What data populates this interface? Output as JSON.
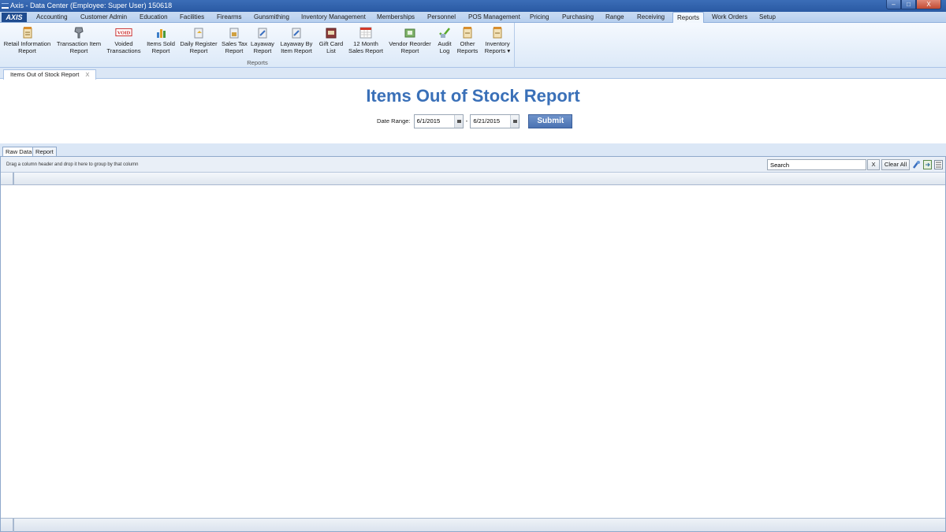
{
  "window": {
    "title": "Axis - Data Center  (Employee: Super User) 150618",
    "minimize": "–",
    "maximize": "□",
    "close": "X"
  },
  "logo": "AXIS",
  "menu": [
    "Accounting",
    "Customer Admin",
    "Education",
    "Facilities",
    "Firearms",
    "Gunsmithing",
    "Inventory Management",
    "Memberships",
    "Personnel",
    "POS Management",
    "Pricing",
    "Purchasing",
    "Range",
    "Receiving",
    "Reports",
    "Work Orders",
    "Setup"
  ],
  "menu_active": "Reports",
  "ribbon": {
    "group_label": "Reports",
    "buttons": [
      {
        "line1": "Retail Information",
        "line2": "Report",
        "icon": "retail-report-icon"
      },
      {
        "line1": "Transaction Item",
        "line2": "Report",
        "icon": "transaction-item-icon"
      },
      {
        "line1": "Voided",
        "line2": "Transactions",
        "icon": "void-stamp-icon",
        "badge": "VOID"
      },
      {
        "line1": "Items Sold",
        "line2": "Report",
        "icon": "items-sold-icon"
      },
      {
        "line1": "Daily Register",
        "line2": "Report",
        "icon": "daily-register-icon"
      },
      {
        "line1": "Sales Tax",
        "line2": "Report",
        "icon": "sales-tax-icon"
      },
      {
        "line1": "Layaway",
        "line2": "Report",
        "icon": "layaway-icon"
      },
      {
        "line1": "Layaway By",
        "line2": "Item Report",
        "icon": "layaway-item-icon"
      },
      {
        "line1": "Gift Card",
        "line2": "List",
        "icon": "gift-card-icon"
      },
      {
        "line1": "12 Month",
        "line2": "Sales Report",
        "icon": "calendar-icon"
      },
      {
        "line1": "Vendor Reorder",
        "line2": "Report",
        "icon": "vendor-reorder-icon"
      },
      {
        "line1": "Audit",
        "line2": "Log",
        "icon": "audit-check-icon"
      },
      {
        "line1": "Other",
        "line2": "Reports",
        "icon": "other-reports-icon"
      },
      {
        "line1": "Inventory",
        "line2": "Reports ▾",
        "icon": "inventory-reports-icon"
      }
    ]
  },
  "doc_tab": {
    "label": "Items Out of Stock Report",
    "close": "X"
  },
  "report": {
    "title": "Items Out of Stock Report",
    "date_range_label": "Date Range:",
    "start_date": "6/1/2015",
    "end_date": "6/21/2015",
    "dash": "-",
    "submit": "Submit"
  },
  "subtabs": [
    "Raw Data",
    "Report"
  ],
  "grid": {
    "group_hint": "Drag a column header and drop it here to group by that column",
    "search_value": "Search",
    "clear_x": "X",
    "clear_all": "Clear All"
  },
  "colors": {
    "accent": "#3a70b8",
    "titlebar": "#2a5aa3"
  }
}
